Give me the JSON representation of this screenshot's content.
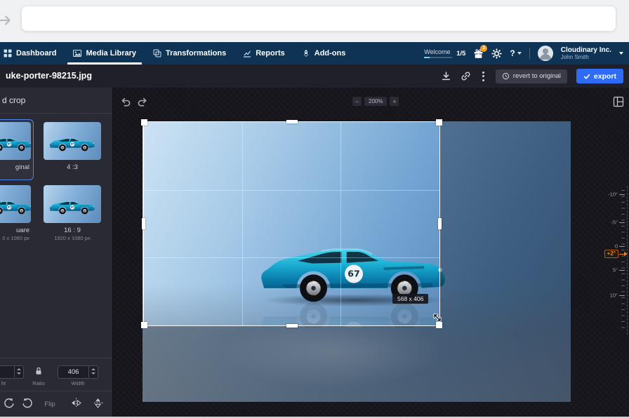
{
  "colors": {
    "accent_blue": "#2e6bf6",
    "nav_navy": "#0e3355",
    "rotation_orange": "#f0821e",
    "badge_orange": "#f59a23",
    "selected_border": "#4d84e8"
  },
  "nav": {
    "items": [
      {
        "label": "Dashboard"
      },
      {
        "label": "Media Library"
      },
      {
        "label": "Transformations"
      },
      {
        "label": "Reports"
      },
      {
        "label": "Add-ons"
      }
    ],
    "welcome_label": "Welcome",
    "progress": "1/5",
    "badge_count": "2",
    "help_glyph": "?",
    "company": "Cloudinary Inc.",
    "user": "John Smith"
  },
  "titlebar": {
    "filename": "uke-porter-98215.jpg",
    "revert_label": "revert to original",
    "export_label": "export"
  },
  "sidebar": {
    "header": "d crop",
    "presets": [
      {
        "label": "ginal",
        "sub": "",
        "selected": true
      },
      {
        "label": "4 :3",
        "sub": "",
        "selected": false
      },
      {
        "label": "uare",
        "sub": "0 x 1080 px",
        "selected": false
      },
      {
        "label": "16 : 9",
        "sub": "1920 x 1080 px",
        "selected": false
      }
    ],
    "height_label": "ht",
    "ratio_label": "Ratio",
    "width_value": "406",
    "width_label": "Width",
    "flip_label": "Flip"
  },
  "canvas": {
    "zoom_out": "−",
    "zoom_level": "200%",
    "zoom_in": "+",
    "crop_size": "568 x 406",
    "car_number": "67"
  },
  "ruler": {
    "labels": [
      "-10°",
      "-5°",
      "0",
      "5°",
      "10°"
    ],
    "current": "+2°"
  }
}
